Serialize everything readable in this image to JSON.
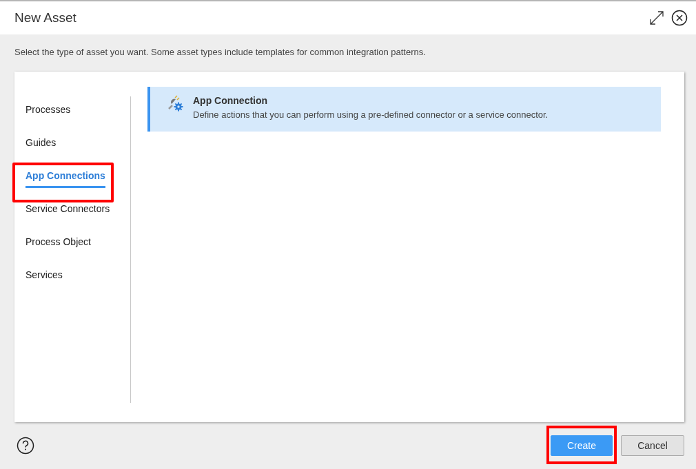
{
  "window": {
    "title": "New Asset"
  },
  "description": "Select the type of asset you want. Some asset types include templates for common integration patterns.",
  "sidebar": {
    "items": [
      {
        "label": "Processes",
        "selected": false,
        "highlighted": false
      },
      {
        "label": "Guides",
        "selected": false,
        "highlighted": false
      },
      {
        "label": "App Connections",
        "selected": true,
        "highlighted": true
      },
      {
        "label": "Service Connectors",
        "selected": false,
        "highlighted": false
      },
      {
        "label": "Process Object",
        "selected": false,
        "highlighted": false
      },
      {
        "label": "Services",
        "selected": false,
        "highlighted": false
      }
    ]
  },
  "assets": [
    {
      "title": "App Connection",
      "description": "Define actions that you can perform using a pre-defined connector or a service connector.",
      "selected": true
    }
  ],
  "buttons": [
    {
      "label": "Create",
      "kind": "primary",
      "highlighted": true
    },
    {
      "label": "Cancel",
      "kind": "secondary",
      "highlighted": false
    }
  ]
}
